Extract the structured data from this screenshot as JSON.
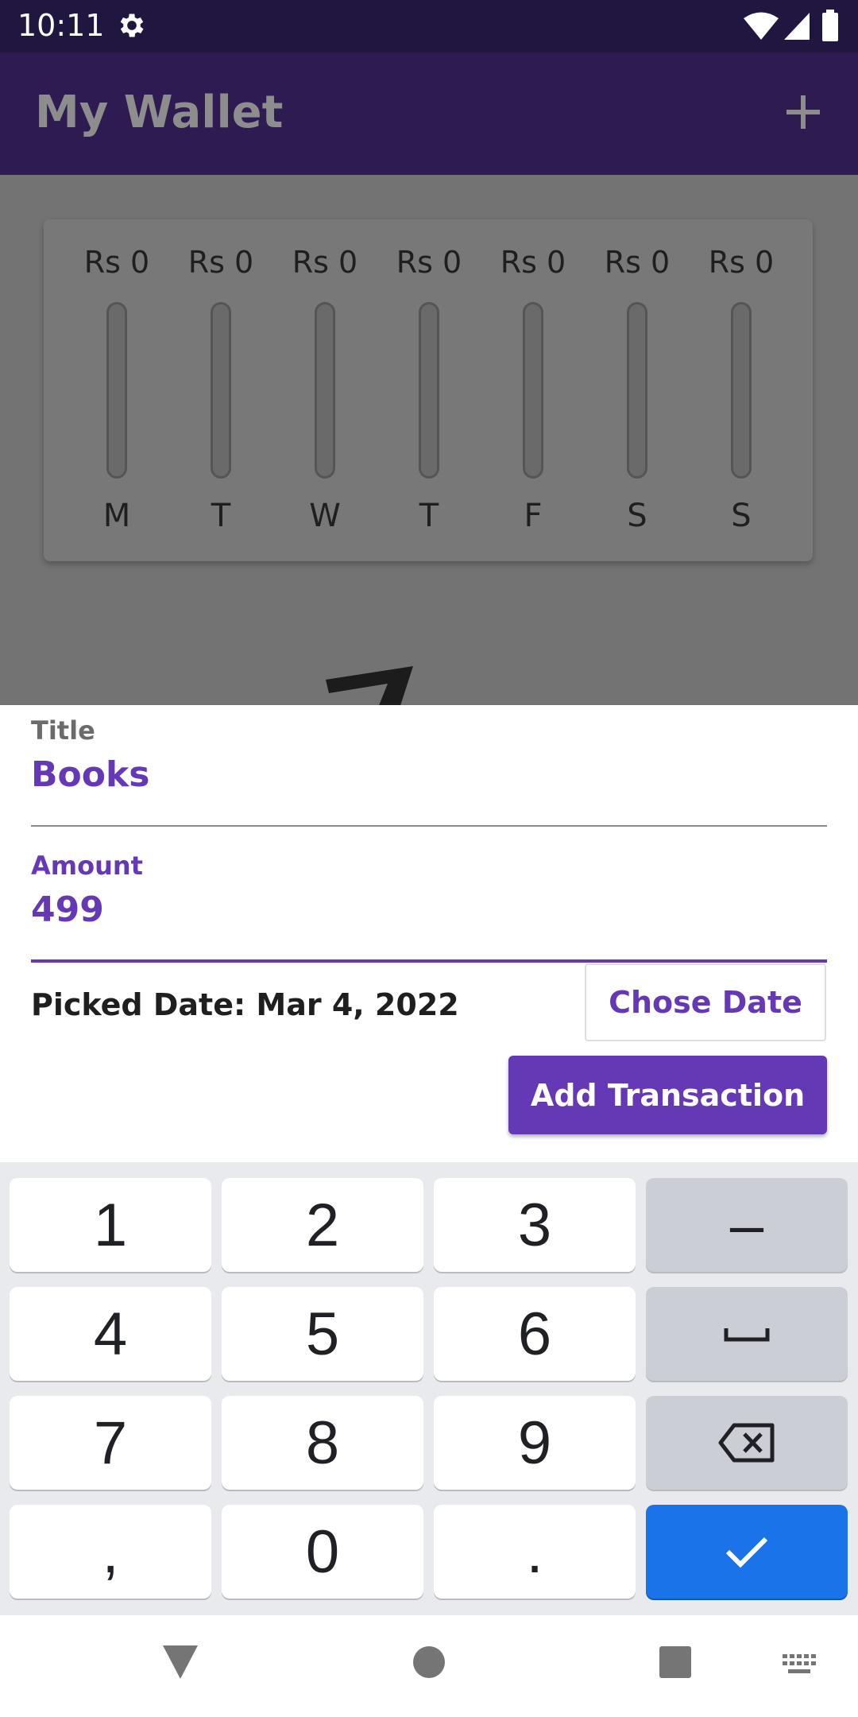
{
  "status_bar": {
    "time": "10:11"
  },
  "app_bar": {
    "title": "My Wallet"
  },
  "weekly_chart": {
    "days": [
      {
        "day": "M",
        "amount": "Rs 0",
        "fill_fraction": 0
      },
      {
        "day": "T",
        "amount": "Rs 0",
        "fill_fraction": 0
      },
      {
        "day": "W",
        "amount": "Rs 0",
        "fill_fraction": 0
      },
      {
        "day": "T",
        "amount": "Rs 0",
        "fill_fraction": 0
      },
      {
        "day": "F",
        "amount": "Rs 0",
        "fill_fraction": 0
      },
      {
        "day": "S",
        "amount": "Rs 0",
        "fill_fraction": 0
      },
      {
        "day": "S",
        "amount": "Rs 0",
        "fill_fraction": 0
      }
    ]
  },
  "form": {
    "title_label": "Title",
    "title_value": "Books",
    "amount_label": "Amount",
    "amount_value": "499",
    "picked_date": "Picked Date: Mar 4, 2022",
    "chose_date_label": "Chose Date",
    "add_transaction_label": "Add Transaction"
  },
  "keyboard": {
    "rows": [
      [
        "1",
        "2",
        "3",
        "-"
      ],
      [
        "4",
        "5",
        "6",
        "space"
      ],
      [
        "7",
        "8",
        "9",
        "backspace"
      ],
      [
        ",",
        "0",
        ".",
        "done"
      ]
    ],
    "keys": {
      "k1": "1",
      "k2": "2",
      "k3": "3",
      "k4": "4",
      "k5": "5",
      "k6": "6",
      "k7": "7",
      "k8": "8",
      "k9": "9",
      "k0": "0",
      "comma": ",",
      "period": ".",
      "minus": "–"
    }
  },
  "colors": {
    "primary": "#6539b5",
    "app_bar": "#2e1b52",
    "status_bar": "#211640",
    "scrim": "#737373",
    "keyboard_accent": "#1a73e8"
  }
}
